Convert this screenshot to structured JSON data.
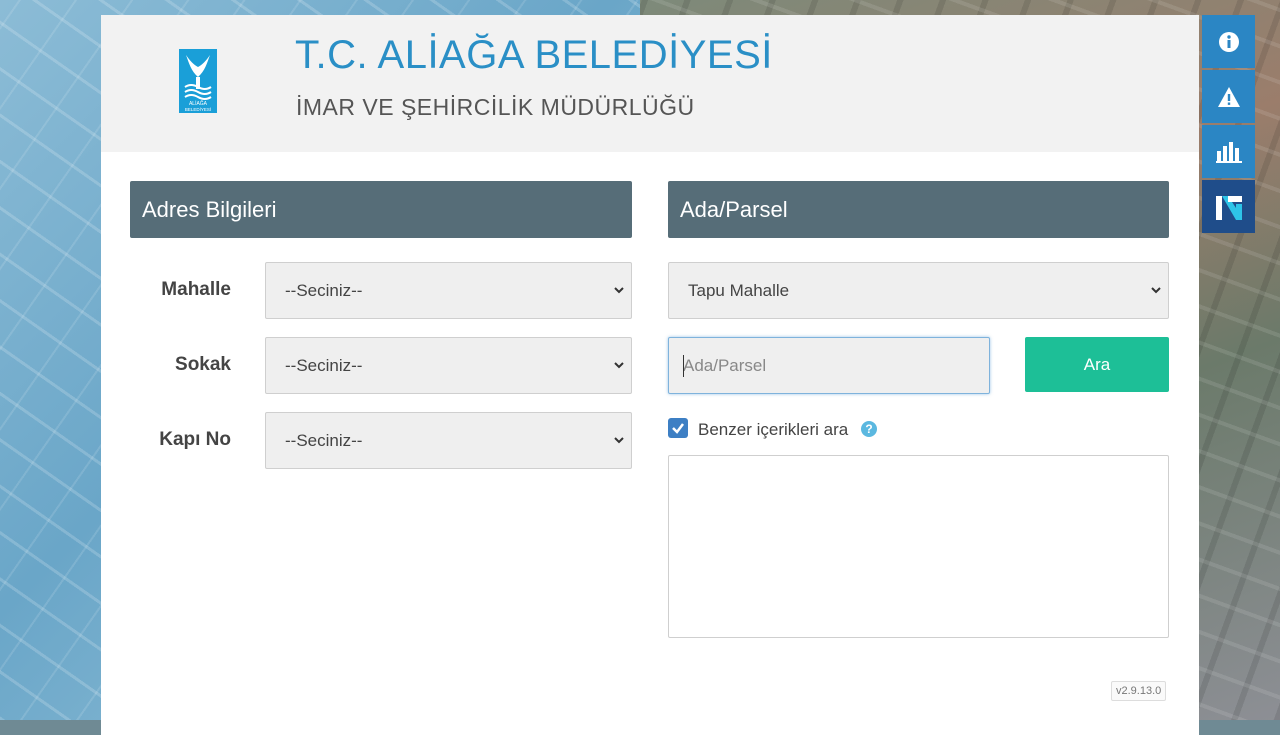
{
  "header": {
    "title": "T.C. ALİAĞA BELEDİYESİ",
    "subtitle": "İMAR VE ŞEHİRCİLİK MÜDÜRLÜĞÜ",
    "logo_text_line1": "ALİAĞA",
    "logo_text_line2": "BELEDİYESİ"
  },
  "address_panel": {
    "title": "Adres Bilgileri",
    "fields": [
      {
        "label": "Mahalle",
        "value": "--Seciniz--"
      },
      {
        "label": "Sokak",
        "value": "--Seciniz--"
      },
      {
        "label": "Kapı No",
        "value": "--Seciniz--"
      }
    ]
  },
  "parcel_panel": {
    "title": "Ada/Parsel",
    "district_select": "Tapu Mahalle",
    "search_placeholder": "Ada/Parsel",
    "search_button": "Ara",
    "similar_label": "Benzer içerikleri ara",
    "similar_checked": true
  },
  "version": "v2.9.13.0",
  "side_toolbar": [
    "info-icon",
    "warning-icon",
    "bar-chart-icon",
    "netcad-logo-icon"
  ],
  "colors": {
    "title": "#2a8fc6",
    "panel_header": "#566d78",
    "search_button": "#1dbf97",
    "side_button": "#2b86c4"
  }
}
